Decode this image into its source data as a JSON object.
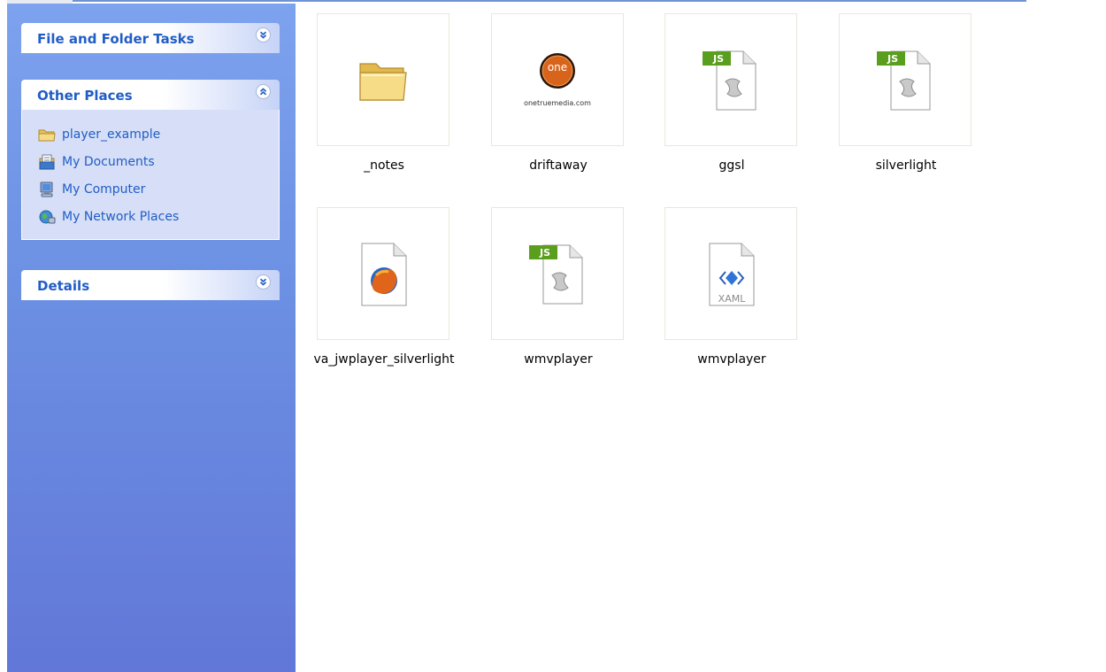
{
  "task_pane": {
    "panels": [
      {
        "title": "File and Folder Tasks",
        "state": "collapsed",
        "chevron": "double-chevron-down-icon"
      },
      {
        "title": "Other Places",
        "state": "expanded",
        "chevron": "double-chevron-up-icon",
        "items": [
          {
            "label": "player_example",
            "icon": "folder-icon"
          },
          {
            "label": "My Documents",
            "icon": "my-documents-icon"
          },
          {
            "label": "My Computer",
            "icon": "my-computer-icon"
          },
          {
            "label": "My Network Places",
            "icon": "network-places-icon"
          }
        ]
      },
      {
        "title": "Details",
        "state": "collapsed",
        "chevron": "double-chevron-down-icon"
      }
    ]
  },
  "files": [
    {
      "name": "_notes",
      "icon": "folder-icon"
    },
    {
      "name": "driftaway",
      "icon": "image-thumbnail",
      "thumbnail_text": {
        "badge": "one",
        "caption": "onetruemedia.com"
      }
    },
    {
      "name": "ggsl",
      "icon": "js-file-icon",
      "badge": "JS"
    },
    {
      "name": "silverlight",
      "icon": "js-file-icon",
      "badge": "JS"
    },
    {
      "name": "va_jwplayer_silverlight",
      "icon": "firefox-html-icon"
    },
    {
      "name": "wmvplayer",
      "icon": "js-file-icon",
      "badge": "JS"
    },
    {
      "name": "wmvplayer",
      "icon": "xaml-file-icon",
      "badge": "XAML"
    }
  ],
  "colors": {
    "pane_top": "#7da2ee",
    "pane_bottom": "#6277d8",
    "panel_title": "#215dc6",
    "panel_body": "#d6dff7",
    "js_badge": "#5a9e1d",
    "thumb_border": "#e9e7da"
  }
}
